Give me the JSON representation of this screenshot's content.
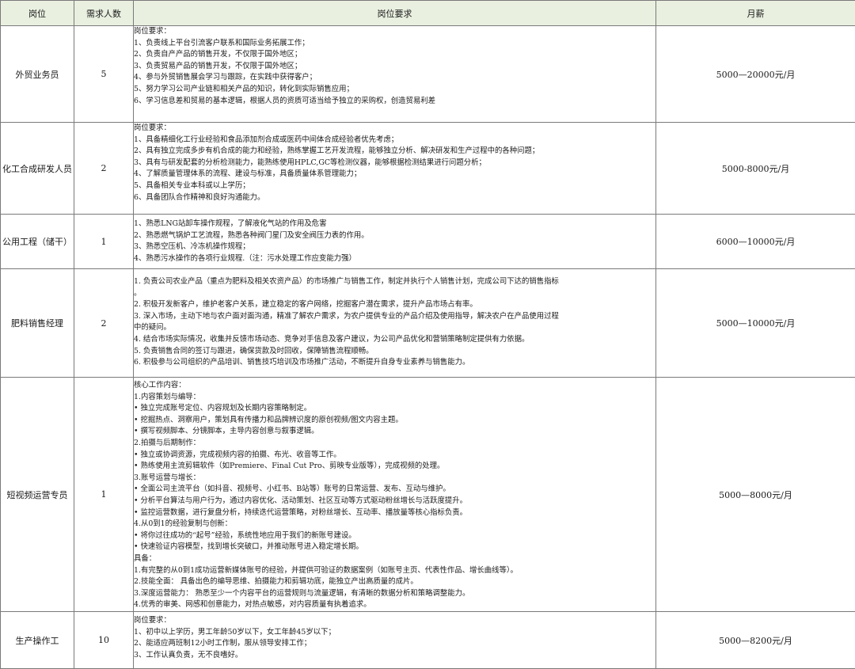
{
  "header": {
    "position": "岗位",
    "count": "需求人数",
    "requirements": "岗位要求",
    "salary": "月薪"
  },
  "jobs": [
    {
      "position": "外贸业务员",
      "count": "5",
      "salary": "5000—20000元/月",
      "lines": [
        "岗位要求：",
        "1、负责线上平台引流客户联系和国际业务拓展工作；",
        "2、负责自产产品的销售开发，不仅限于国外地区；",
        "3、负责贸易产品的销售开发，不仅限于国外地区；",
        "4、参与外贸销售展会学习与跟踪，在实践中获得客户；",
        "5、努力学习公司产业链和相关产品的知识，转化到实际销售应用；",
        "6、学习信息差和贸易的基本逻辑，根据人员的资质可适当给予独立的采购权，创造贸易利差"
      ]
    },
    {
      "position": "化工合成研发人员",
      "count": "2",
      "salary": "5000-8000元/月",
      "lines": [
        "岗位要求：",
        "1、具备精细化工行业经验和食品添加剂合成或医药中间体合成经验者优先考虑；",
        "2、具有独立完成多步有机合成的能力和经验，熟练掌握工艺开发流程，能够独立分析、解决研发和生产过程中的各种问题；",
        "3、具有与研发配套的分析检测能力，能熟练使用HPLC,GC等检测仪器，能够根据检测结果进行问题分析；",
        "4、了解质量管理体系的流程、建设与标准，具备质量体系管理能力；",
        "5、具备相关专业本科或以上学历；",
        "6、具备团队合作精神和良好沟通能力。"
      ]
    },
    {
      "position": "公用工程（储干）",
      "count": "1",
      "salary": "6000—10000元/月",
      "lines": [
        "1、熟悉LNG站卸车操作规程，了解液化气站的作用及危害",
        "2、熟悉燃气锅炉工艺流程，熟悉各种阀门星门及安全阀压力表的作用。",
        "3、熟悉空压机、冷冻机操作规程；",
        "4、熟悉污水操作的各项行业规程.（注：污水处理工作应变能力强）"
      ]
    },
    {
      "position": "肥料销售经理",
      "count": "2",
      "salary": "5000—10000元/月",
      "lines": [
        "1. 负责公司农业产品（重点为肥料及相关农资产品）的市场推广与销售工作，制定并执行个人销售计划，完成公司下达的销售指标",
        "。",
        "2. 积极开发新客户，维护老客户关系，建立稳定的客户网络，挖掘客户潜在需求，提升产品市场占有率。",
        "3. 深入市场，主动下地与农户面对面沟通，精准了解农户需求，为农户提供专业的产品介绍及使用指导，解决农户在产品使用过程",
        "中的疑问。",
        "4. 结合市场实际情况，收集并反馈市场动态、竞争对手信息及客户建议，为公司产品优化和营销策略制定提供有力依据。",
        "5. 负责销售合同的签订与跟进，确保货款及时回收，保障销售流程顺畅。",
        "6. 积极参与公司组织的产品培训、销售技巧培训及市场推广活动，不断提升自身专业素养与销售能力。"
      ]
    },
    {
      "position": "短视频运营专员",
      "count": "1",
      "salary": "5000—8000元/月",
      "lines": [
        "核心工作内容：",
        "1.内容策划与编导：",
        "• 独立完成账号定位、内容规划及长期内容策略制定。",
        "• 挖掘热点、洞察用户，策划具有传播力和品牌辨识度的原创视频/图文内容主题。",
        "• 撰写视频脚本、分镜脚本，主导内容创意与叙事逻辑。",
        "2.拍摄与后期制作：",
        "• 独立或协调资源，完成视频内容的拍摄、布光、收音等工作。",
        "• 熟练使用主流剪辑软件（如Premiere、Final Cut Pro、剪映专业版等），完成视频的处理。",
        "3.账号运营与增长：",
        "• 全面公司主流平台（如抖音、视频号、小红书、B站等）账号的日常运营、发布、互动与维护。",
        "• 分析平台算法与用户行为，通过内容优化、活动策划、社区互动等方式驱动粉丝增长与活跃度提升。",
        "• 监控运营数据，进行复盘分析，持续迭代运营策略，对粉丝增长、互动率、播放量等核心指标负责。",
        "4.从0到1的经验复制与创新：",
        "• 将你过往成功的“起号”经验，系统性地应用于我们的新账号建设。",
        "• 快速验证内容模型，找到增长突破口，并推动账号进入稳定增长期。",
        "具备：",
        "1.有完整的从0到1成功运营新媒体账号的经验，并提供可验证的数据案例（如账号主页、代表性作品、增长曲线等）。",
        "2.技能全面：  具备出色的编导思维、拍摄能力和剪辑功底，能独立产出高质量的成片。",
        "3.深度运营能力：  熟悉至少一个内容平台的运营规则与流量逻辑，有清晰的数据分析和策略调整能力。",
        "4.优秀的审美、网感和创意能力，对热点敏感，对内容质量有执着追求。"
      ]
    },
    {
      "position": "生产操作工",
      "count": "10",
      "salary": "5000—8200元/月",
      "lines": [
        "岗位要求：",
        "1、初中以上学历，男工年龄50岁以下，女工年龄45岁以下；",
        "2、能适应两班制12小时工作制，服从领导安排工作；",
        "3、工作认真负责，无不良嗜好。"
      ]
    }
  ]
}
